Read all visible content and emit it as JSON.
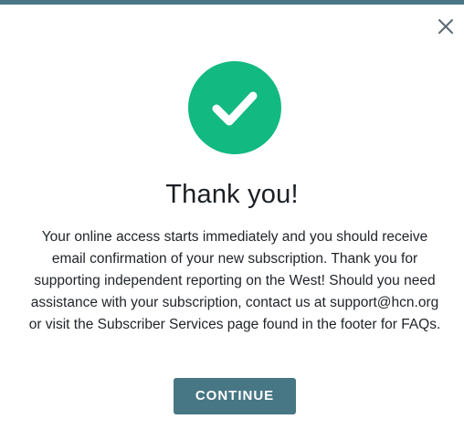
{
  "dialog": {
    "title": "Thank you!",
    "message": "Your online access starts immediately and you should receive email confirmation of your new subscription. Thank you for supporting independent reporting on the West! Should you need assistance with your subscription, contact us at support@hcn.org or visit the Subscriber Services page found in the footer for FAQs.",
    "continue_label": "CONTINUE",
    "close_icon": "close-icon",
    "success_icon": "checkmark-circle-icon"
  },
  "colors": {
    "accent": "#477684",
    "success": "#12b981",
    "text": "#1f2328",
    "close_icon": "#5b6b75"
  }
}
